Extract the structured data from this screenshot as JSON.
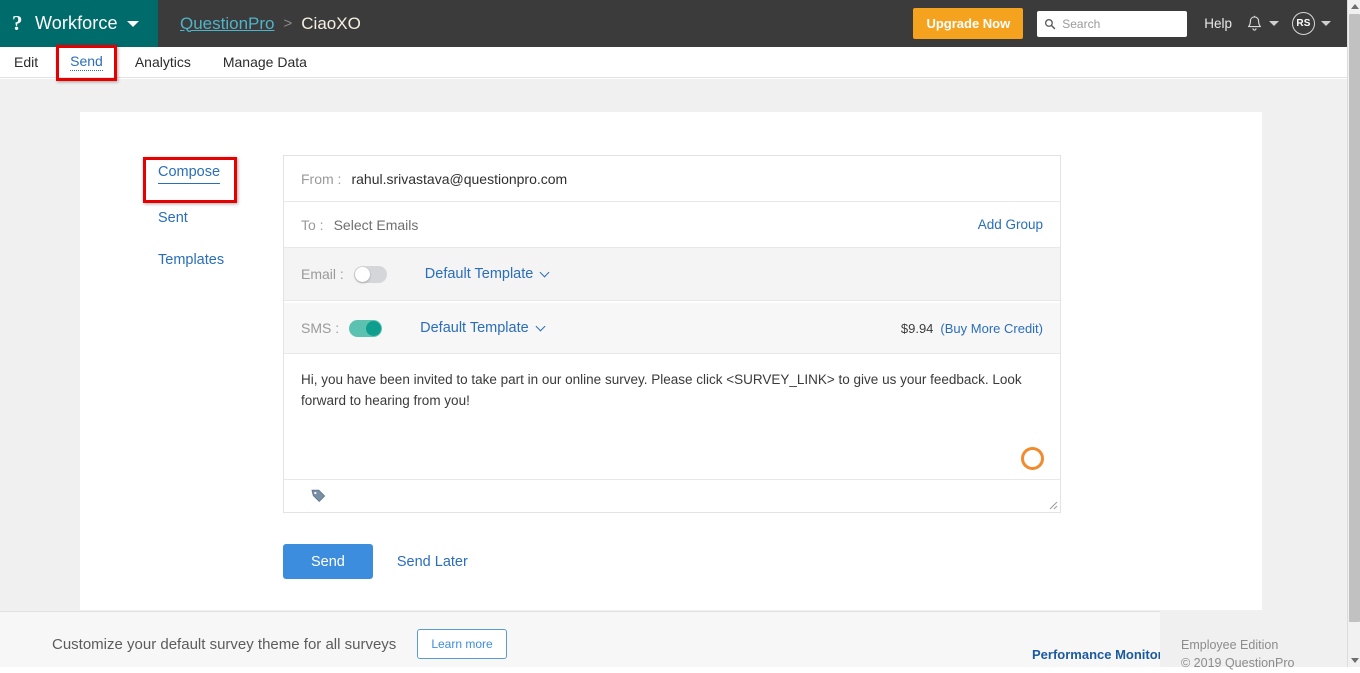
{
  "header": {
    "logo_glyph": "?",
    "brand": "Workforce",
    "breadcrumb": {
      "root": "QuestionPro",
      "separator": ">",
      "current": "CiaoXO"
    },
    "upgrade_label": "Upgrade Now",
    "search_placeholder": "Search",
    "search_value": "",
    "help_label": "Help",
    "avatar_initials": "RS",
    "colors": {
      "brand_teal": "#006b6b",
      "bar_dark": "#3b3b3b",
      "upgrade_orange": "#f5a21e",
      "breadcrumb_link": "#4fb3c9"
    }
  },
  "subnav": {
    "items": [
      {
        "label": "Edit",
        "active": false
      },
      {
        "label": "Send",
        "active": true
      },
      {
        "label": "Analytics",
        "active": false
      },
      {
        "label": "Manage Data",
        "active": false
      }
    ]
  },
  "sidebar": {
    "items": [
      {
        "label": "Compose",
        "active": true
      },
      {
        "label": "Sent",
        "active": false
      },
      {
        "label": "Templates",
        "active": false
      }
    ]
  },
  "compose": {
    "from": {
      "label": "From :",
      "value": "rahul.srivastava@questionpro.com"
    },
    "to": {
      "label": "To :",
      "value": "Select Emails",
      "add_group_label": "Add Group"
    },
    "email_channel": {
      "label": "Email :",
      "enabled": false,
      "template_label": "Default Template"
    },
    "sms_channel": {
      "label": "SMS :",
      "enabled": true,
      "template_label": "Default Template",
      "credit_amount": "$9.94",
      "buy_credit_label": "(Buy More Credit)"
    },
    "message": "Hi, you have been invited to take part in our online survey. Please click <SURVEY_LINK> to give us your feedback. Look forward to hearing from you!",
    "tag_icon": "tag-icon",
    "counter_ring": "character-counter-ring"
  },
  "actions": {
    "send_label": "Send",
    "send_later_label": "Send Later",
    "send_color": "#3c8dde"
  },
  "footer": {
    "promo_text": "Customize your default survey theme for all surveys",
    "learn_more_label": "Learn more",
    "performance_monitor_label": "Performance Monitor",
    "edition": "Employee Edition",
    "copyright": "© 2019 QuestionPro"
  }
}
